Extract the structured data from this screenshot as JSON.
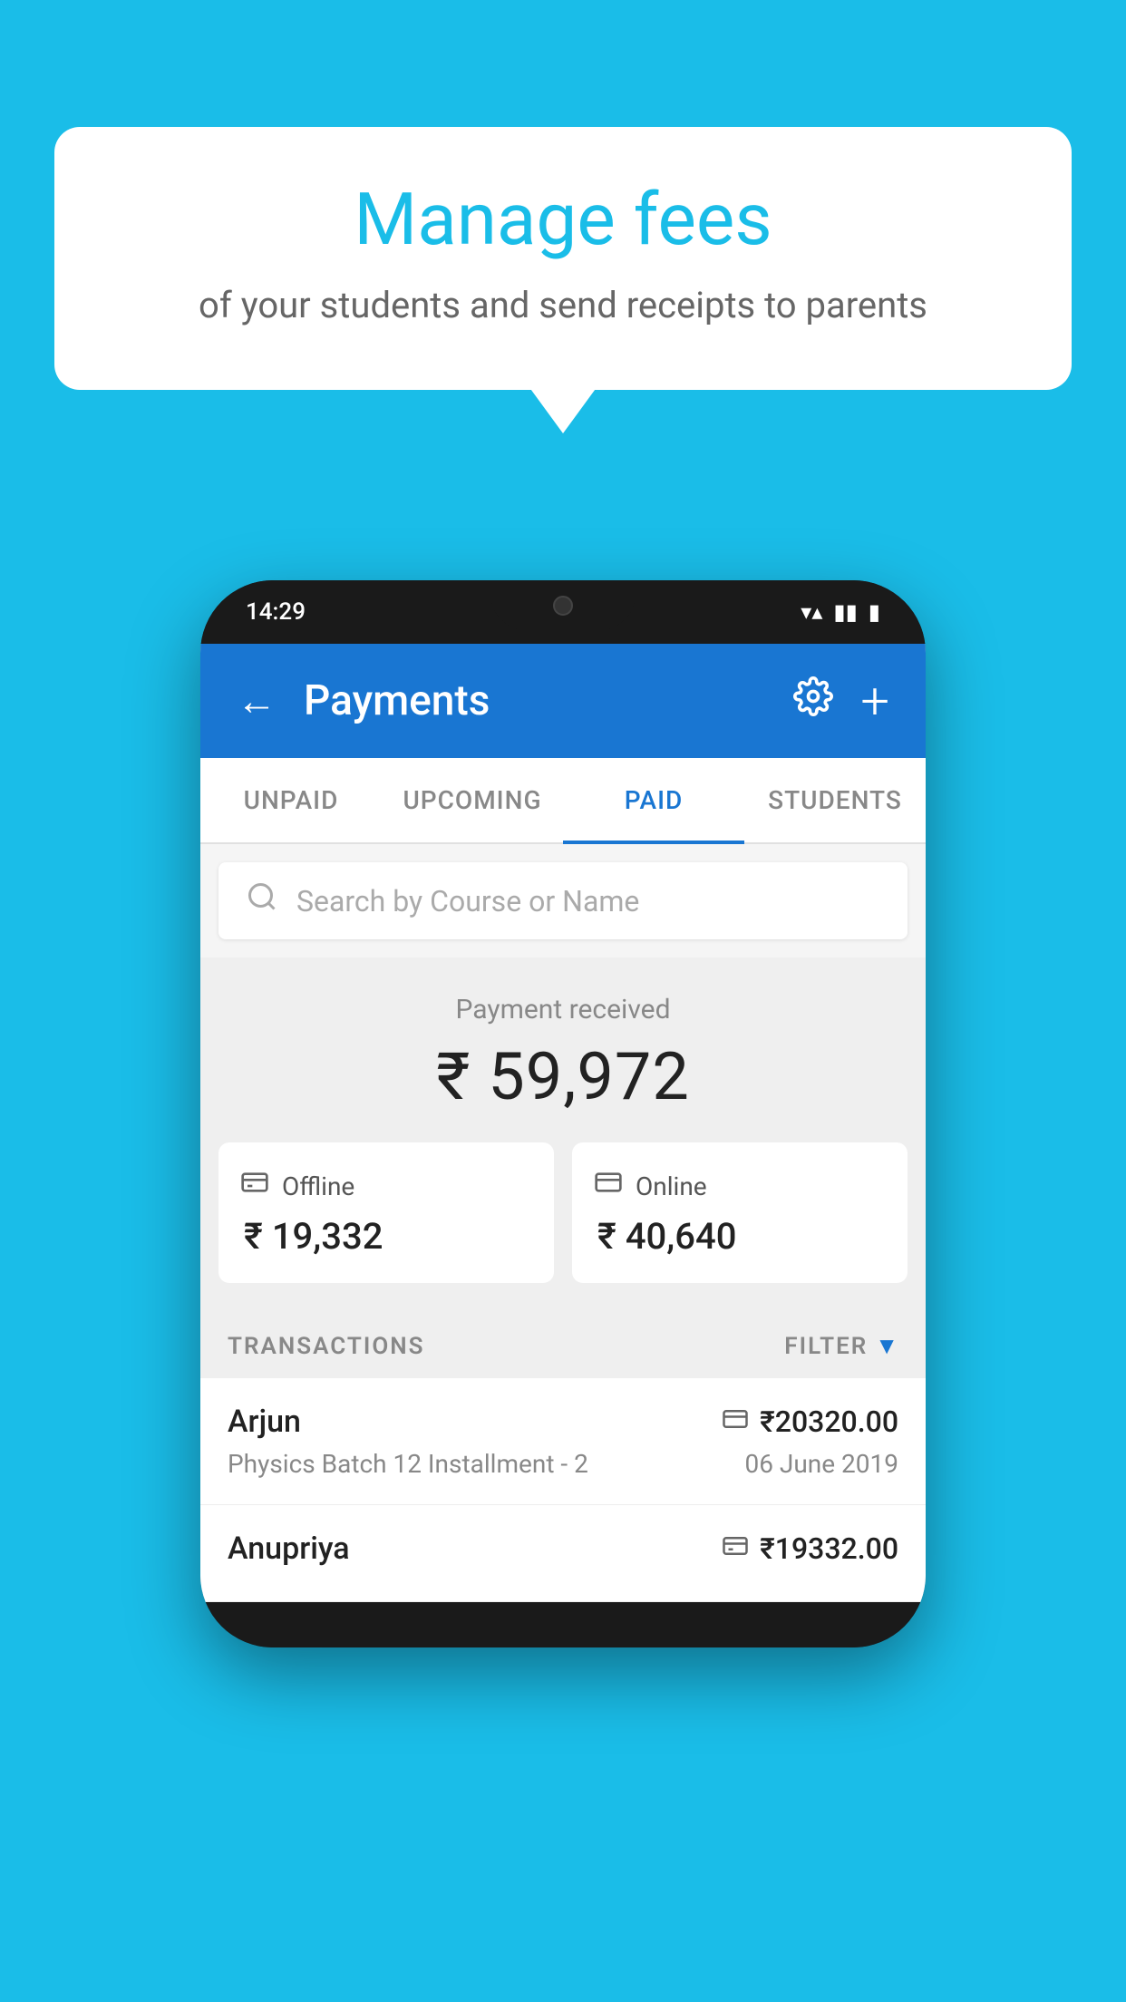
{
  "background_color": "#1ABDE8",
  "bubble": {
    "title": "Manage fees",
    "subtitle": "of your students and send receipts to parents"
  },
  "phone": {
    "status_bar": {
      "time": "14:29",
      "icons": [
        "▼",
        "▲",
        "▮"
      ]
    },
    "header": {
      "title": "Payments",
      "back_label": "←",
      "settings_label": "⚙",
      "add_label": "+"
    },
    "tabs": [
      {
        "label": "UNPAID",
        "active": false
      },
      {
        "label": "UPCOMING",
        "active": false
      },
      {
        "label": "PAID",
        "active": true
      },
      {
        "label": "STUDENTS",
        "active": false
      }
    ],
    "search": {
      "placeholder": "Search by Course or Name"
    },
    "payment_received": {
      "label": "Payment received",
      "amount": "₹ 59,972",
      "offline": {
        "icon": "💳",
        "label": "Offline",
        "amount": "₹ 19,332"
      },
      "online": {
        "icon": "💳",
        "label": "Online",
        "amount": "₹ 40,640"
      }
    },
    "transactions": {
      "header_label": "TRANSACTIONS",
      "filter_label": "FILTER",
      "items": [
        {
          "name": "Arjun",
          "course": "Physics Batch 12 Installment - 2",
          "amount": "₹20320.00",
          "date": "06 June 2019",
          "mode": "online"
        },
        {
          "name": "Anupriya",
          "course": "",
          "amount": "₹19332.00",
          "date": "",
          "mode": "offline"
        }
      ]
    }
  }
}
